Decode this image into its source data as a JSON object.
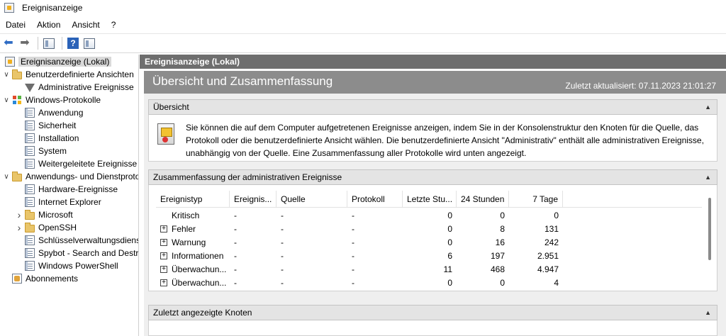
{
  "window": {
    "title": "Ereignisanzeige"
  },
  "menu": {
    "items": [
      "Datei",
      "Aktion",
      "Ansicht",
      "?"
    ]
  },
  "tree": {
    "items": [
      {
        "label": "Ereignisanzeige (Lokal)",
        "icon": "event-viewer-icon",
        "level": 0,
        "expander": "",
        "selected": true
      },
      {
        "label": "Benutzerdefinierte Ansichten",
        "icon": "folder-icon",
        "level": 0,
        "expander": "expanded"
      },
      {
        "label": "Administrative Ereignisse",
        "icon": "filter-icon",
        "level": 1,
        "expander": ""
      },
      {
        "label": "Windows-Protokolle",
        "icon": "windows-logs-icon",
        "level": 0,
        "expander": "expanded"
      },
      {
        "label": "Anwendung",
        "icon": "log-icon",
        "level": 1,
        "expander": ""
      },
      {
        "label": "Sicherheit",
        "icon": "log-icon",
        "level": 1,
        "expander": ""
      },
      {
        "label": "Installation",
        "icon": "log-icon",
        "level": 1,
        "expander": ""
      },
      {
        "label": "System",
        "icon": "log-icon",
        "level": 1,
        "expander": ""
      },
      {
        "label": "Weitergeleitete Ereignisse",
        "icon": "log-icon",
        "level": 1,
        "expander": ""
      },
      {
        "label": "Anwendungs- und Dienstprotokolle",
        "icon": "folder-icon",
        "level": 0,
        "expander": "expanded"
      },
      {
        "label": "Hardware-Ereignisse",
        "icon": "log-icon",
        "level": 1,
        "expander": ""
      },
      {
        "label": "Internet Explorer",
        "icon": "log-icon",
        "level": 1,
        "expander": ""
      },
      {
        "label": "Microsoft",
        "icon": "folder-icon",
        "level": 1,
        "expander": "collapsed"
      },
      {
        "label": "OpenSSH",
        "icon": "folder-icon",
        "level": 1,
        "expander": "collapsed"
      },
      {
        "label": "Schlüsselverwaltungsdienst",
        "icon": "log-icon",
        "level": 1,
        "expander": ""
      },
      {
        "label": "Spybot - Search and Destroy",
        "icon": "log-icon",
        "level": 1,
        "expander": ""
      },
      {
        "label": "Windows PowerShell",
        "icon": "log-icon",
        "level": 1,
        "expander": ""
      },
      {
        "label": "Abonnements",
        "icon": "subscriptions-icon",
        "level": 0,
        "expander": ""
      }
    ]
  },
  "content": {
    "header": "Ereignisanzeige (Lokal)",
    "banner_title": "Übersicht und Zusammenfassung",
    "updated": "Zuletzt aktualisiert: 07.11.2023 21:01:27",
    "overview": {
      "title": "Übersicht",
      "text": "Sie können die auf dem Computer aufgetretenen Ereignisse anzeigen, indem Sie in der Konsolenstruktur den Knoten für die Quelle, das Protokoll oder die benutzerdefinierte Ansicht wählen. Die benutzerdefinierte Ansicht \"Administrativ\" enthält alle administrativen Ereignisse, unabhängig von der Quelle. Eine Zusammenfassung aller Protokolle wird unten angezeigt."
    },
    "summary": {
      "title": "Zusammenfassung der administrativen Ereignisse",
      "columns": [
        "Ereignistyp",
        "Ereignis...",
        "Quelle",
        "Protokoll",
        "Letzte Stu...",
        "24 Stunden",
        "7 Tage"
      ],
      "rows": [
        {
          "type": "Kritisch",
          "expandable": false,
          "id": "-",
          "source": "-",
          "log": "-",
          "hour": "0",
          "day": "0",
          "week": "0"
        },
        {
          "type": "Fehler",
          "expandable": true,
          "id": "-",
          "source": "-",
          "log": "-",
          "hour": "0",
          "day": "8",
          "week": "131"
        },
        {
          "type": "Warnung",
          "expandable": true,
          "id": "-",
          "source": "-",
          "log": "-",
          "hour": "0",
          "day": "16",
          "week": "242"
        },
        {
          "type": "Informationen",
          "expandable": true,
          "id": "-",
          "source": "-",
          "log": "-",
          "hour": "6",
          "day": "197",
          "week": "2.951"
        },
        {
          "type": "Überwachun...",
          "expandable": true,
          "id": "-",
          "source": "-",
          "log": "-",
          "hour": "11",
          "day": "468",
          "week": "4.947"
        },
        {
          "type": "Überwachun...",
          "expandable": true,
          "id": "-",
          "source": "-",
          "log": "-",
          "hour": "0",
          "day": "0",
          "week": "4"
        }
      ]
    },
    "recent": {
      "title": "Zuletzt angezeigte Knoten"
    }
  }
}
